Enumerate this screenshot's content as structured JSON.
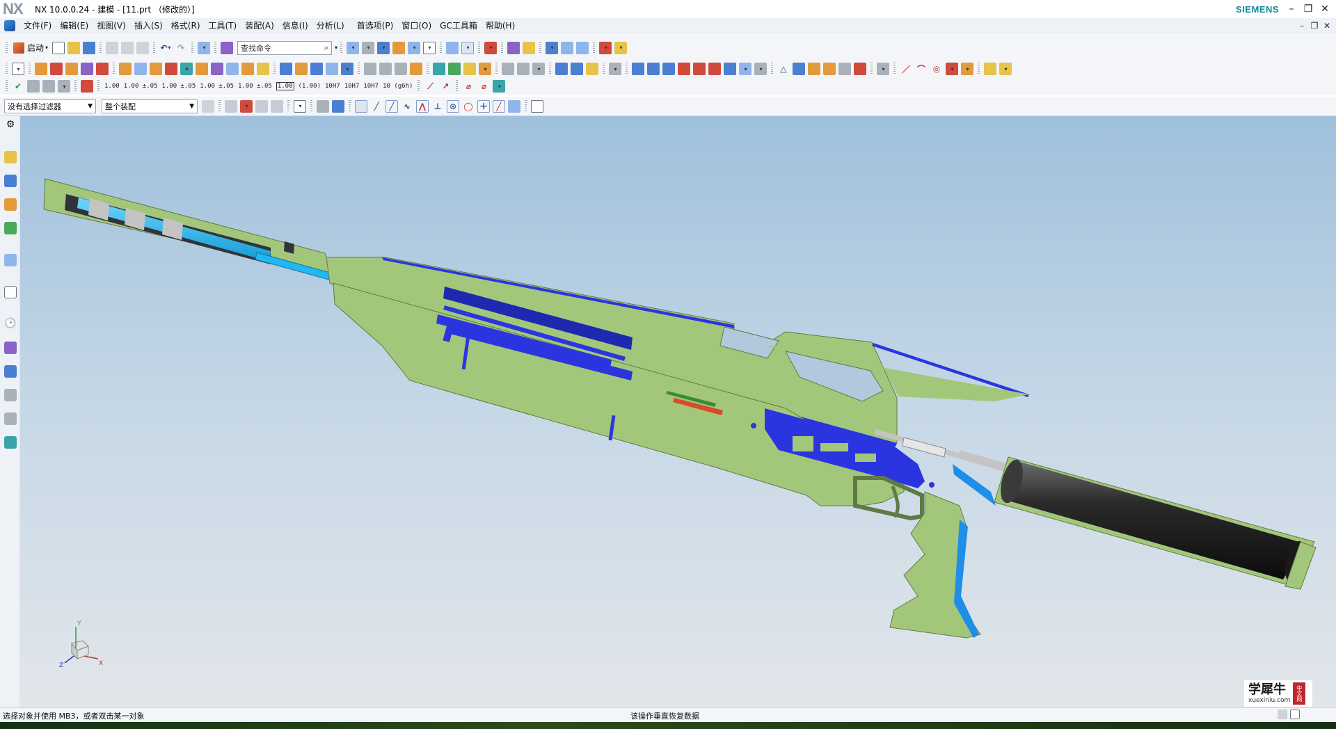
{
  "app": {
    "logo": "NX",
    "title": "NX 10.0.0.24 - 建模 - [11.prt （修改的）]",
    "brand": "SIEMENS"
  },
  "menu": {
    "items": [
      "文件(F)",
      "编辑(E)",
      "视图(V)",
      "插入(S)",
      "格式(R)",
      "工具(T)",
      "装配(A)",
      "信息(I)",
      "分析(L)",
      "首选项(P)",
      "窗口(O)",
      "GC工具箱",
      "帮助(H)"
    ]
  },
  "toolbar": {
    "start_label": "启动",
    "search_placeholder": "查找命令",
    "dimension_texts": [
      "1.00",
      "1.00\n±.05",
      "1.00\n±.05",
      "1.00\n±.05",
      "1.00\n±.05",
      "1.00",
      "(1.00)",
      "10H7",
      "10H7",
      "10H7",
      "10\n(g6h)"
    ]
  },
  "selection_bar": {
    "filter_value": "没有选择过滤器",
    "scope_value": "整个装配"
  },
  "viewport": {
    "triad": {
      "x": "X",
      "y": "Y",
      "z": "Z"
    },
    "watermark": {
      "title": "学犀牛",
      "sub": "xuexiniu.com",
      "badge": "中文网"
    },
    "colors": {
      "body": "#a3c77a",
      "part_blue": "#2a35e0",
      "part_cyan": "#20b8f0",
      "steel": "#c4c4c4",
      "tank": "#1e1e1e"
    }
  },
  "status": {
    "left": "选择对象并使用 MB3，或者双击某一对象",
    "middle": "该操作垂直恢复数据"
  }
}
